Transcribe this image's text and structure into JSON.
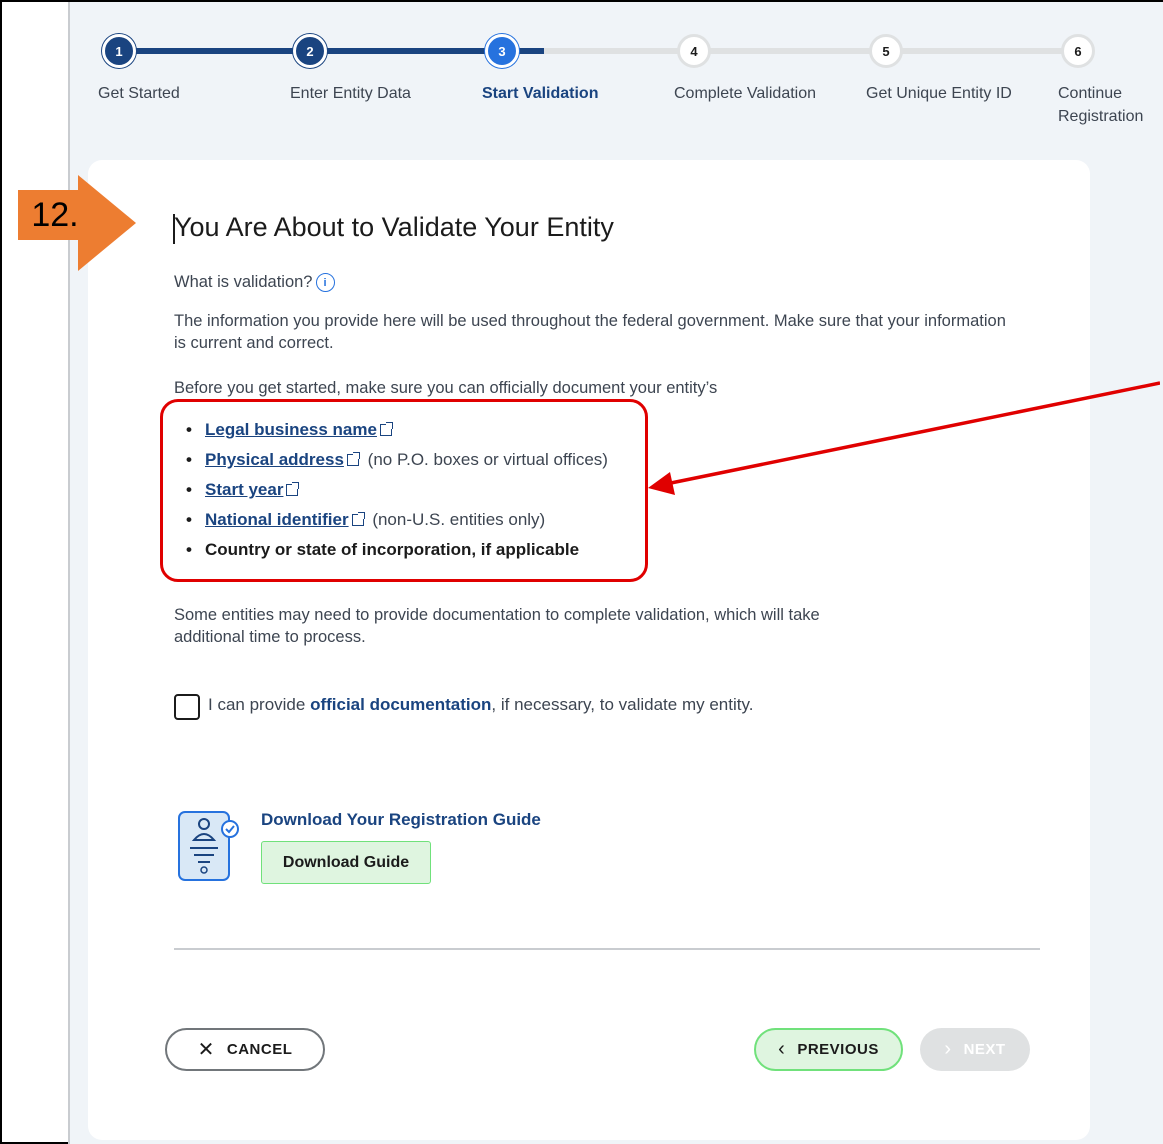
{
  "badge": {
    "label": "12."
  },
  "stepper": {
    "steps": [
      {
        "number": "1",
        "label": "Get Started",
        "state": "done"
      },
      {
        "number": "2",
        "label": "Enter Entity Data",
        "state": "done"
      },
      {
        "number": "3",
        "label": "Start Validation",
        "state": "current"
      },
      {
        "number": "4",
        "label": "Complete Validation",
        "state": "todo"
      },
      {
        "number": "5",
        "label": "Get Unique Entity ID",
        "state": "todo"
      },
      {
        "number": "6",
        "label": "Continue Registration",
        "state": "todo"
      }
    ]
  },
  "main": {
    "title": "You Are About to Validate Your Entity",
    "what_is": "What is validation?",
    "intro": "The information you provide here will be used throughout the federal government. Make sure that your information is current and correct.",
    "before": "Before you get started, make sure you can officially document your entity’s",
    "requirements": [
      {
        "link": "Legal business name",
        "note": ""
      },
      {
        "link": "Physical address",
        "note": "(no P.O. boxes or virtual offices)"
      },
      {
        "link": "Start year",
        "note": ""
      },
      {
        "link": "National identifier",
        "note": "(non-U.S. entities only)"
      }
    ],
    "requirement_bold": "Country or state of incorporation, if applicable",
    "docs_note": "Some entities may need to provide documentation to complete validation, which will take additional time to process.",
    "checkbox": {
      "prefix": "I can provide ",
      "bold": "official documentation",
      "suffix": ", if necessary, to validate my entity."
    },
    "guide": {
      "title": "Download Your Registration Guide",
      "button": "Download Guide"
    }
  },
  "footer": {
    "cancel": "CANCEL",
    "previous": "PREVIOUS",
    "next": "NEXT"
  },
  "colors": {
    "primary": "#1a4480",
    "current": "#2672de",
    "highlight": "#e00000",
    "badge": "#ed7d31",
    "success": "#70e17b"
  }
}
